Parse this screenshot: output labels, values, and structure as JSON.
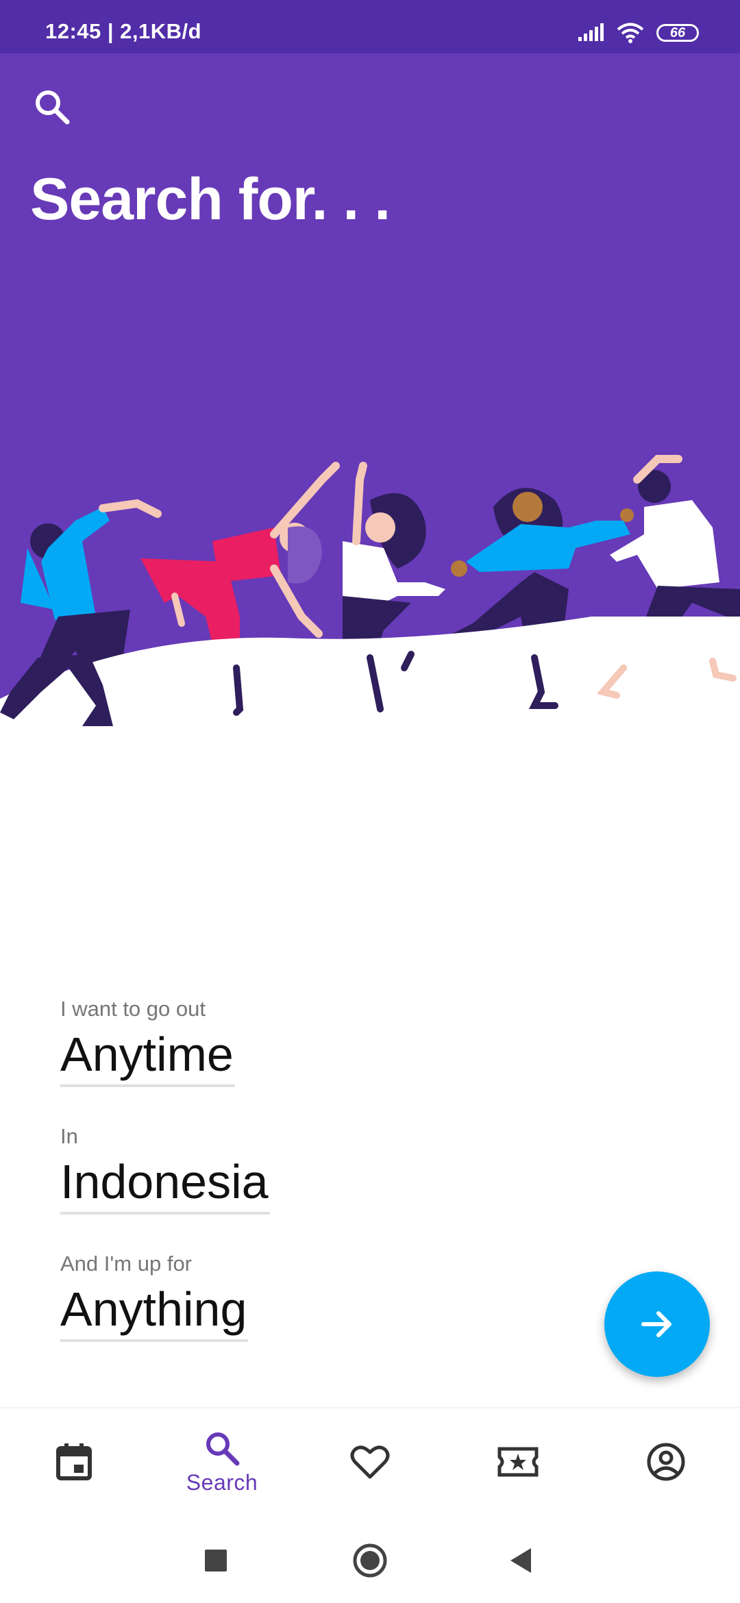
{
  "status_bar": {
    "time": "12:45 | 2,1KB/d",
    "battery": "66"
  },
  "header": {
    "title": "Search for. . ."
  },
  "form": {
    "when_label": "I want to go out",
    "when_value": "Anytime",
    "where_label": "In",
    "where_value": "Indonesia",
    "what_label": "And I'm up for",
    "what_value": "Anything"
  },
  "bottom_nav": {
    "items": [
      {
        "icon": "calendar-icon",
        "label": ""
      },
      {
        "icon": "search-icon",
        "label": "Search",
        "active": true
      },
      {
        "icon": "heart-icon",
        "label": ""
      },
      {
        "icon": "ticket-icon",
        "label": ""
      },
      {
        "icon": "account-icon",
        "label": ""
      }
    ]
  },
  "colors": {
    "primary": "#673AB7",
    "primary_dark": "#512DA8",
    "accent": "#03A9F4"
  }
}
